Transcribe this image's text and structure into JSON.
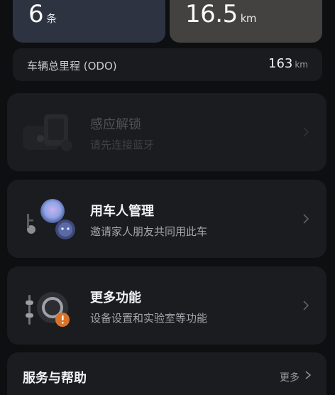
{
  "stats": {
    "left": {
      "value": "6",
      "unit": "条"
    },
    "right": {
      "value": "16.5",
      "unit": "km"
    }
  },
  "odo": {
    "label": "车辆总里程 (ODO)",
    "value": "163",
    "unit": "km"
  },
  "cards": [
    {
      "title": "感应解锁",
      "subtitle": "请先连接蓝牙",
      "icon": "phone-key-icon",
      "enabled": false
    },
    {
      "title": "用车人管理",
      "subtitle": "邀请家人朋友共同用此车",
      "icon": "users-key-icon",
      "enabled": true
    },
    {
      "title": "更多功能",
      "subtitle": "设备设置和实验室等功能",
      "icon": "settings-lab-icon",
      "enabled": true
    }
  ],
  "service": {
    "title": "服务与帮助",
    "more": "更多"
  },
  "colors": {
    "background": "#0e0f11",
    "card": "#1b1c1f",
    "stat_left": "#2d3340",
    "stat_right": "#444240",
    "badge": "#d9732a"
  }
}
